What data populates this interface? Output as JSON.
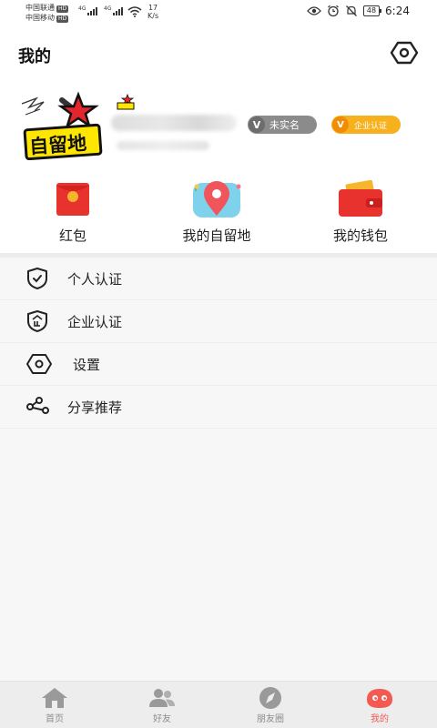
{
  "status_bar": {
    "carrier_1": "中国联通",
    "carrier_2": "中国移动",
    "hd_label": "HD",
    "network_label": "4G",
    "net_speed_value": "17",
    "net_speed_unit": "K/s",
    "battery_level": "48",
    "time": "6:24"
  },
  "header": {
    "title": "我的",
    "settings_icon": "hexagon-settings-icon"
  },
  "profile": {
    "avatar_text": "自留地",
    "badge_unverified": {
      "icon_letter": "V",
      "label": "未实名"
    },
    "badge_enterprise": {
      "icon_letter": "V",
      "label": "企业认证"
    }
  },
  "quick_actions": [
    {
      "label": "红包",
      "icon": "red-envelope-icon"
    },
    {
      "label": "我的自留地",
      "icon": "map-pin-icon"
    },
    {
      "label": "我的钱包",
      "icon": "wallet-icon"
    }
  ],
  "menu": [
    {
      "label": "个人认证",
      "icon": "shield-check-icon"
    },
    {
      "label": "企业认证",
      "icon": "shield-enterprise-icon"
    },
    {
      "label": "设置",
      "icon": "hexagon-settings-icon"
    },
    {
      "label": "分享推荐",
      "icon": "share-icon"
    }
  ],
  "tab_bar": {
    "active_index": 3,
    "tabs": [
      {
        "label": "首页",
        "icon": "home-icon"
      },
      {
        "label": "好友",
        "icon": "friends-icon"
      },
      {
        "label": "朋友圈",
        "icon": "compass-icon"
      },
      {
        "label": "我的",
        "icon": "me-icon"
      }
    ]
  },
  "colors": {
    "accent_red": "#f25a52",
    "badge_gray": "#8b8b8b",
    "badge_gold": "#f6b11c",
    "tab_inactive": "#8e8e8e"
  }
}
